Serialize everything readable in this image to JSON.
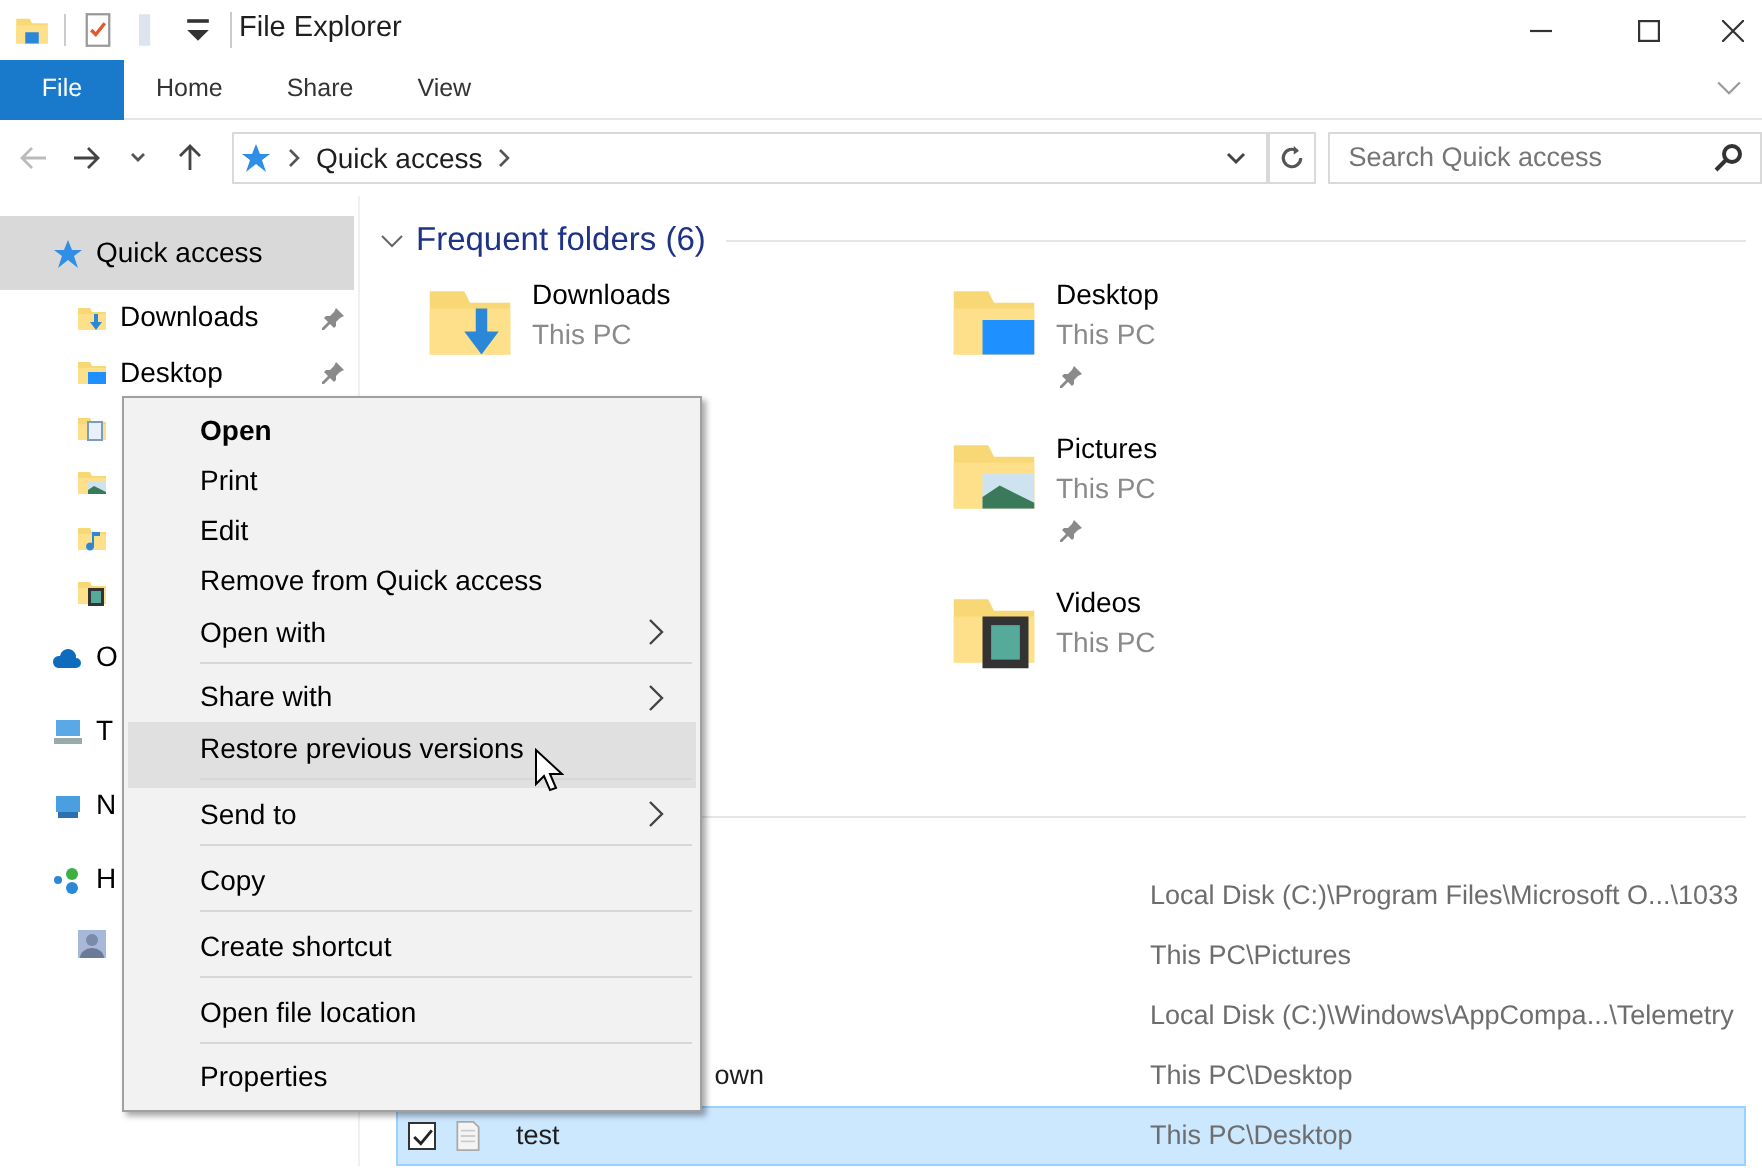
{
  "title_bar": {
    "title": "File Explorer"
  },
  "ribbon_tabs": [
    {
      "label": "File",
      "kind": "file"
    },
    {
      "label": "Home",
      "kind": "tab"
    },
    {
      "label": "Share",
      "kind": "tab"
    },
    {
      "label": "View",
      "kind": "tab"
    }
  ],
  "address_bar": {
    "crumbs": [
      "Quick access"
    ]
  },
  "search": {
    "placeholder": "Search Quick access"
  },
  "sidebar": {
    "items": [
      {
        "label": "Quick access",
        "kind": "star",
        "selected": true,
        "children": [
          {
            "label": "Downloads",
            "kind": "downloads",
            "pinned": true
          },
          {
            "label": "Desktop",
            "kind": "desktop",
            "pinned": true
          },
          {
            "kind": "documents"
          },
          {
            "kind": "pictures"
          },
          {
            "kind": "music"
          },
          {
            "kind": "videos"
          }
        ]
      },
      {
        "label": "O",
        "kind": "cloud",
        "selected": false
      },
      {
        "label": "T",
        "kind": "pc",
        "selected": false
      },
      {
        "label": "N",
        "kind": "network",
        "selected": false
      },
      {
        "label": "H",
        "kind": "homegroup",
        "selected": false,
        "children": [
          {
            "kind": "user"
          }
        ]
      }
    ]
  },
  "frequent_folders": {
    "heading": "Frequent folders (6)",
    "expanded": true,
    "folders": [
      {
        "name": "Downloads",
        "location": "This PC",
        "kind": "downloads"
      },
      {
        "name": "Desktop",
        "location": "This PC",
        "kind": "desktop",
        "pinned": true
      },
      {
        "name": "Pictures",
        "location": "This PC",
        "kind": "pictures",
        "pinned": true
      },
      {
        "name": "Videos",
        "location": "This PC",
        "kind": "videos",
        "pinned": false
      }
    ]
  },
  "recent_files": [
    {
      "path": "Local Disk (C:)\\Program Files\\Microsoft O...\\1033",
      "selected": false
    },
    {
      "path": "This PC\\Pictures",
      "selected": false
    },
    {
      "path": "Local Disk (C:)\\Windows\\AppCompa...\\Telemetry",
      "selected": false
    },
    {
      "name": "own",
      "clipped": true,
      "path": "This PC\\Desktop",
      "selected": false
    },
    {
      "name": "test",
      "clipped": false,
      "path": "This PC\\Desktop",
      "selected": true,
      "checked": true
    }
  ],
  "context_menu": [
    {
      "label": "Open",
      "default": true,
      "submenu": false,
      "highlighted": false,
      "separator_after": false
    },
    {
      "label": "Print",
      "default": false,
      "submenu": false,
      "highlighted": false,
      "separator_after": false
    },
    {
      "label": "Edit",
      "default": false,
      "submenu": false,
      "highlighted": false,
      "separator_after": false
    },
    {
      "label": "Remove from Quick access",
      "default": false,
      "submenu": false,
      "highlighted": false,
      "separator_after": false
    },
    {
      "label": "Open with",
      "default": false,
      "submenu": true,
      "highlighted": false,
      "separator_after": true
    },
    {
      "label": "Share with",
      "default": false,
      "submenu": true,
      "highlighted": false,
      "separator_after": false
    },
    {
      "label": "Restore previous versions",
      "default": false,
      "submenu": false,
      "highlighted": true,
      "separator_after": true
    },
    {
      "label": "Send to",
      "default": false,
      "submenu": true,
      "highlighted": false,
      "separator_after": true
    },
    {
      "label": "Copy",
      "default": false,
      "submenu": false,
      "highlighted": false,
      "separator_after": true
    },
    {
      "label": "Create shortcut",
      "default": false,
      "submenu": false,
      "highlighted": false,
      "separator_after": true
    },
    {
      "label": "Open file location",
      "default": false,
      "submenu": false,
      "highlighted": false,
      "separator_after": true
    },
    {
      "label": "Properties",
      "default": false,
      "submenu": false,
      "highlighted": false,
      "separator_after": false
    }
  ]
}
